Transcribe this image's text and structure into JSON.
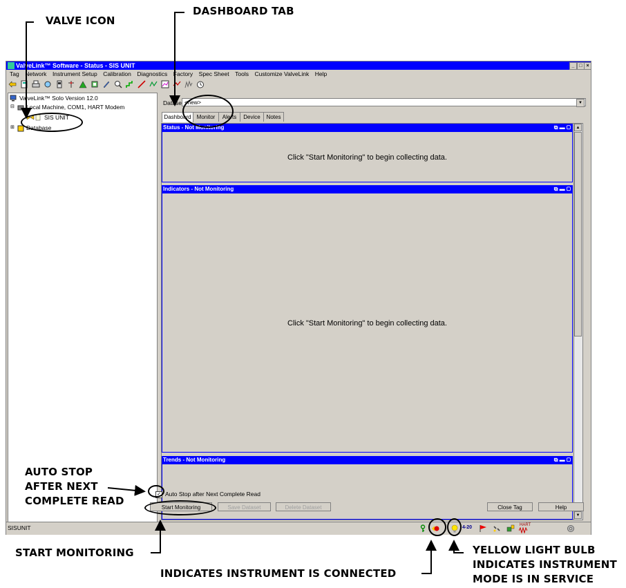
{
  "callouts": {
    "valve_icon": "VALVE ICON",
    "dashboard_tab": "DASHBOARD TAB",
    "auto_stop_1": "AUTO STOP",
    "auto_stop_2": "AFTER NEXT",
    "auto_stop_3": "COMPLETE READ",
    "start_monitoring": "START MONITORING",
    "connected": "INDICATES INSTRUMENT IS CONNECTED",
    "bulb_1": "YELLOW LIGHT BULB",
    "bulb_2": "INDICATES INSTRUMENT",
    "bulb_3": "MODE IS IN SERVICE"
  },
  "window": {
    "title": "ValveLink™ Software - Status - SIS UNIT",
    "min": "_",
    "max": "□",
    "close": "×"
  },
  "menu": [
    "Tag",
    "Network",
    "Instrument Setup",
    "Calibration",
    "Diagnostics",
    "Factory",
    "Spec Sheet",
    "Tools",
    "Customize ValveLink",
    "Help"
  ],
  "tree": {
    "root": "ValveLink™ Solo Version 12.0",
    "machine": "Local Machine, COM1, HART Modem",
    "unit": "SIS UNIT",
    "database": "Database"
  },
  "dataset": {
    "label": "Dataset:",
    "value": "<new>"
  },
  "tabs": [
    "Dashboard",
    "Monitor",
    "Alerts",
    "Device",
    "Notes"
  ],
  "sections": {
    "status": {
      "title": "Status - Not Monitoring",
      "message": "Click \"Start Monitoring\" to begin collecting data."
    },
    "indicators": {
      "title": "Indicators - Not Monitoring",
      "message": "Click \"Start Monitoring\" to begin collecting data."
    },
    "trends": {
      "title": "Trends - Not Monitoring"
    }
  },
  "controls": {
    "auto_stop_label": "Auto Stop after Next Complete Read",
    "auto_stop_checked": "✓",
    "start_monitoring": "Start Monitoring",
    "save_dataset": "Save Dataset",
    "delete_dataset": "Delete Dataset",
    "close_tag": "Close Tag",
    "help": "Help"
  },
  "status": {
    "tag": "SISUNIT",
    "loop": "4-20",
    "hart": "HART"
  },
  "colors": {
    "titlebar": "#0000ff",
    "section_header": "#0000ff",
    "window_bg": "#d4d0c8"
  }
}
